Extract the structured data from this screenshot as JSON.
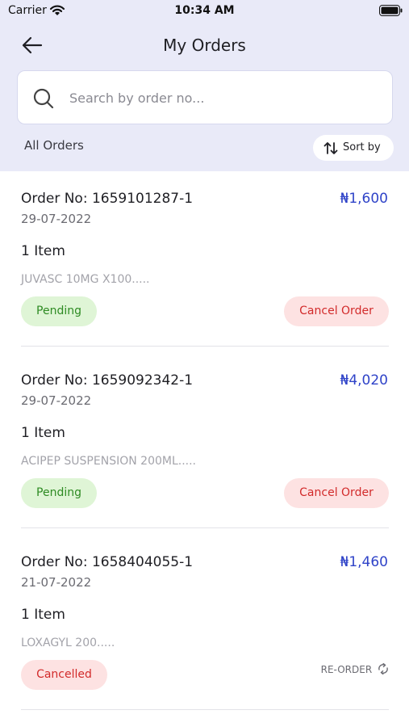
{
  "status_bar": {
    "carrier": "Carrier",
    "time": "10:34 AM"
  },
  "header": {
    "title": "My Orders"
  },
  "search": {
    "placeholder": "Search by order no..."
  },
  "filter": {
    "label": "All Orders",
    "sort_label": "Sort by"
  },
  "orders": [
    {
      "order_no": "Order No: 1659101287-1",
      "date": "29-07-2022",
      "price": "₦1,600",
      "item_count": "1 Item",
      "product": "JUVASC 10MG X100.....",
      "status": "Pending",
      "action": "Cancel Order"
    },
    {
      "order_no": "Order No: 1659092342-1",
      "date": "29-07-2022",
      "price": "₦4,020",
      "item_count": "1 Item",
      "product": "ACIPEP SUSPENSION 200ML.....",
      "status": "Pending",
      "action": "Cancel Order"
    },
    {
      "order_no": "Order No: 1658404055-1",
      "date": "21-07-2022",
      "price": "₦1,460",
      "item_count": "1 Item",
      "product": "LOXAGYL 200.....",
      "status": "Cancelled",
      "action": "RE-ORDER"
    }
  ],
  "icons": {
    "back": "arrow-left-icon",
    "search": "search-icon",
    "sort": "sort-arrows-icon",
    "reorder": "refresh-icon"
  },
  "colors": {
    "header_bg": "#e9eaf8",
    "price": "#2f43c8",
    "pending_bg": "#dff5d6",
    "pending_text": "#2e8b23",
    "cancel_bg": "#fde2e2",
    "cancel_text": "#d22b2b"
  }
}
